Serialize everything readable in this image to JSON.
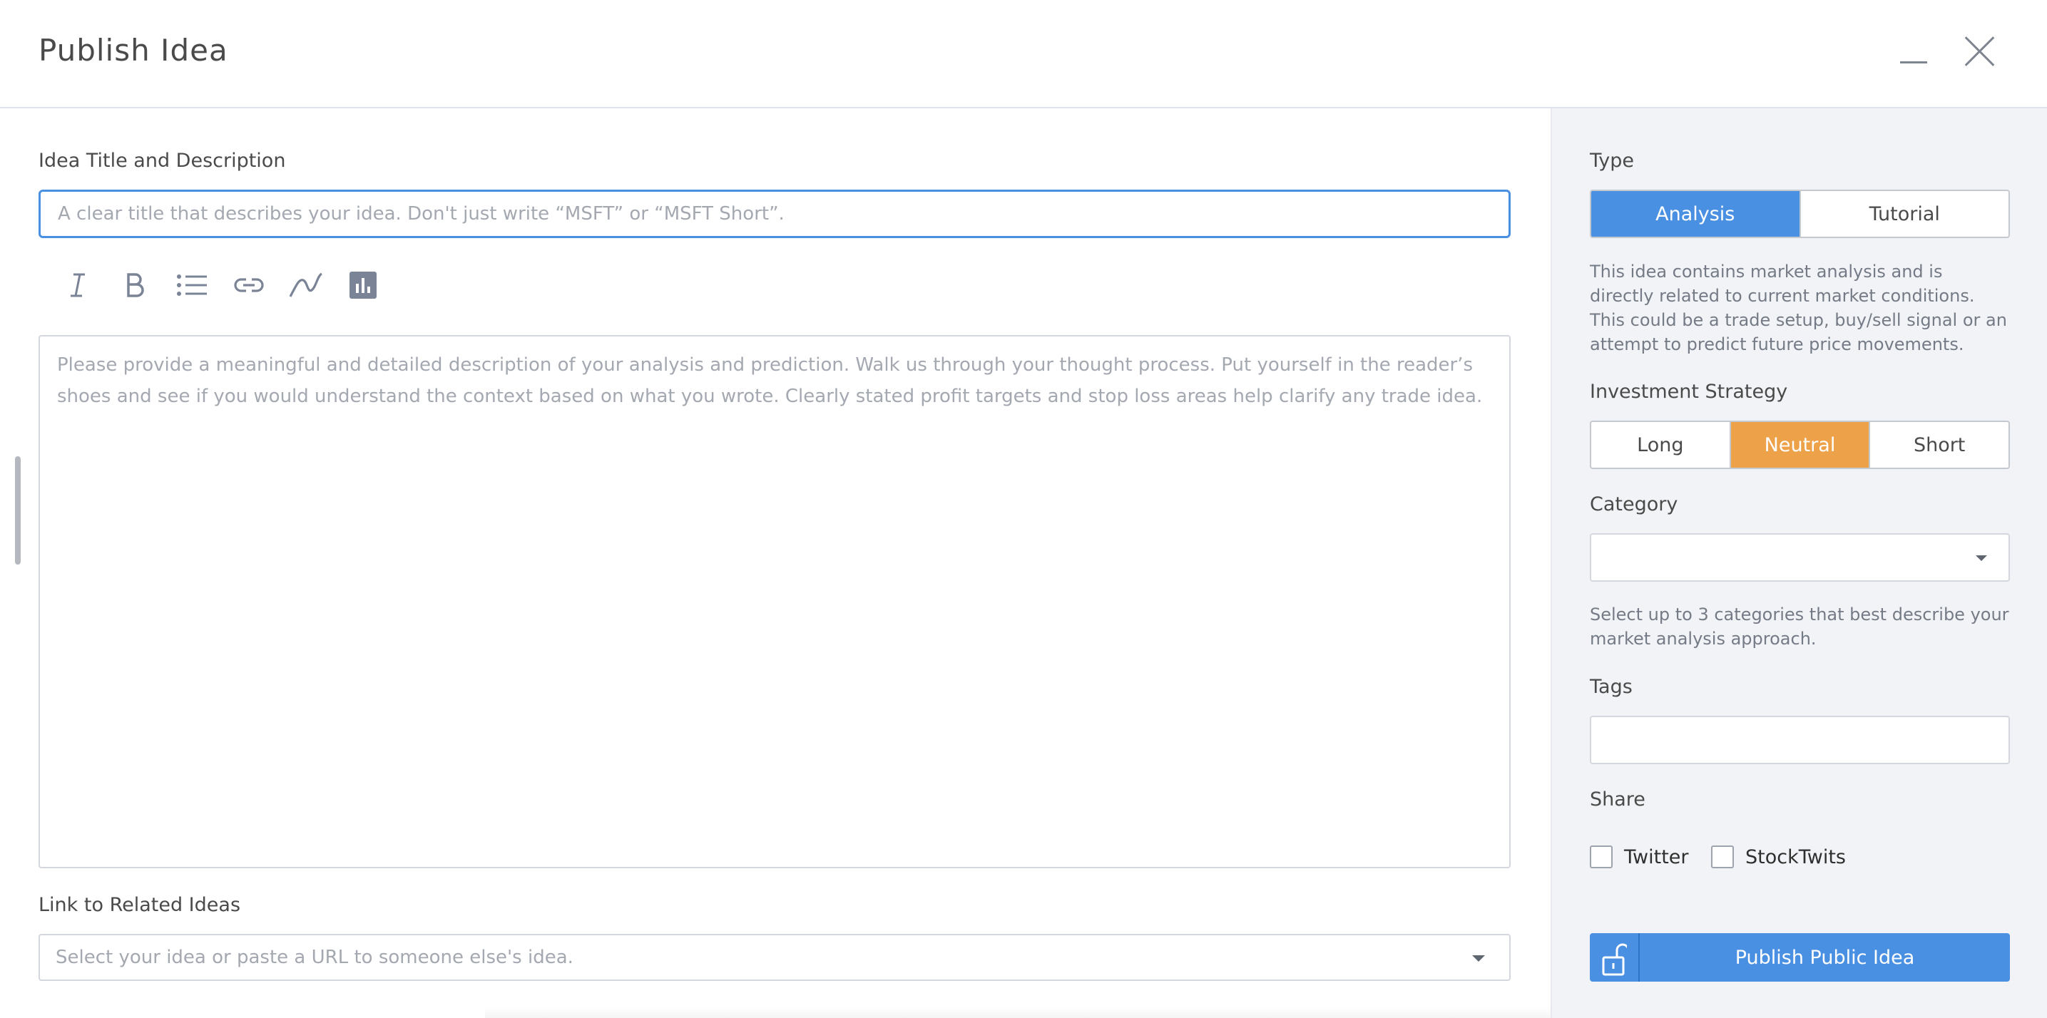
{
  "header": {
    "title": "Publish Idea"
  },
  "main": {
    "title_label": "Idea Title and Description",
    "title_placeholder": "A clear title that describes your idea. Don't just write “MSFT” or “MSFT Short”.",
    "toolbar": [
      "italic-icon",
      "bold-icon",
      "bulleted-list-icon",
      "link-icon",
      "line-chart-icon",
      "bar-chart-icon"
    ],
    "description_placeholder": "Please provide a meaningful and detailed description of your analysis and prediction. Walk us through your thought process. Put yourself in the reader’s shoes and see if you would understand the context based on what you wrote. Clearly stated profit targets and stop loss areas help clarify any trade idea.",
    "related_label": "Link to Related Ideas",
    "related_placeholder": "Select your idea or paste a URL to someone else's idea."
  },
  "sidebar": {
    "type_label": "Type",
    "type_options": [
      "Analysis",
      "Tutorial"
    ],
    "type_selected": "Analysis",
    "type_help": "This idea contains market analysis and is directly related to current market conditions. This could be a trade setup, buy/sell signal or an attempt to predict future price movements.",
    "strategy_label": "Investment Strategy",
    "strategy_options": [
      "Long",
      "Neutral",
      "Short"
    ],
    "strategy_selected": "Neutral",
    "category_label": "Category",
    "category_value": "",
    "category_help": "Select up to 3 categories that best describe your market analysis approach.",
    "tags_label": "Tags",
    "tags_value": "",
    "share_label": "Share",
    "share_options": [
      {
        "label": "Twitter",
        "checked": false
      },
      {
        "label": "StockTwits",
        "checked": false
      }
    ],
    "publish_label": "Publish Public Idea"
  },
  "colors": {
    "accent_blue": "#4a90e2",
    "neutral_orange": "#eda149",
    "sidebar_bg": "#f1f3f6"
  }
}
